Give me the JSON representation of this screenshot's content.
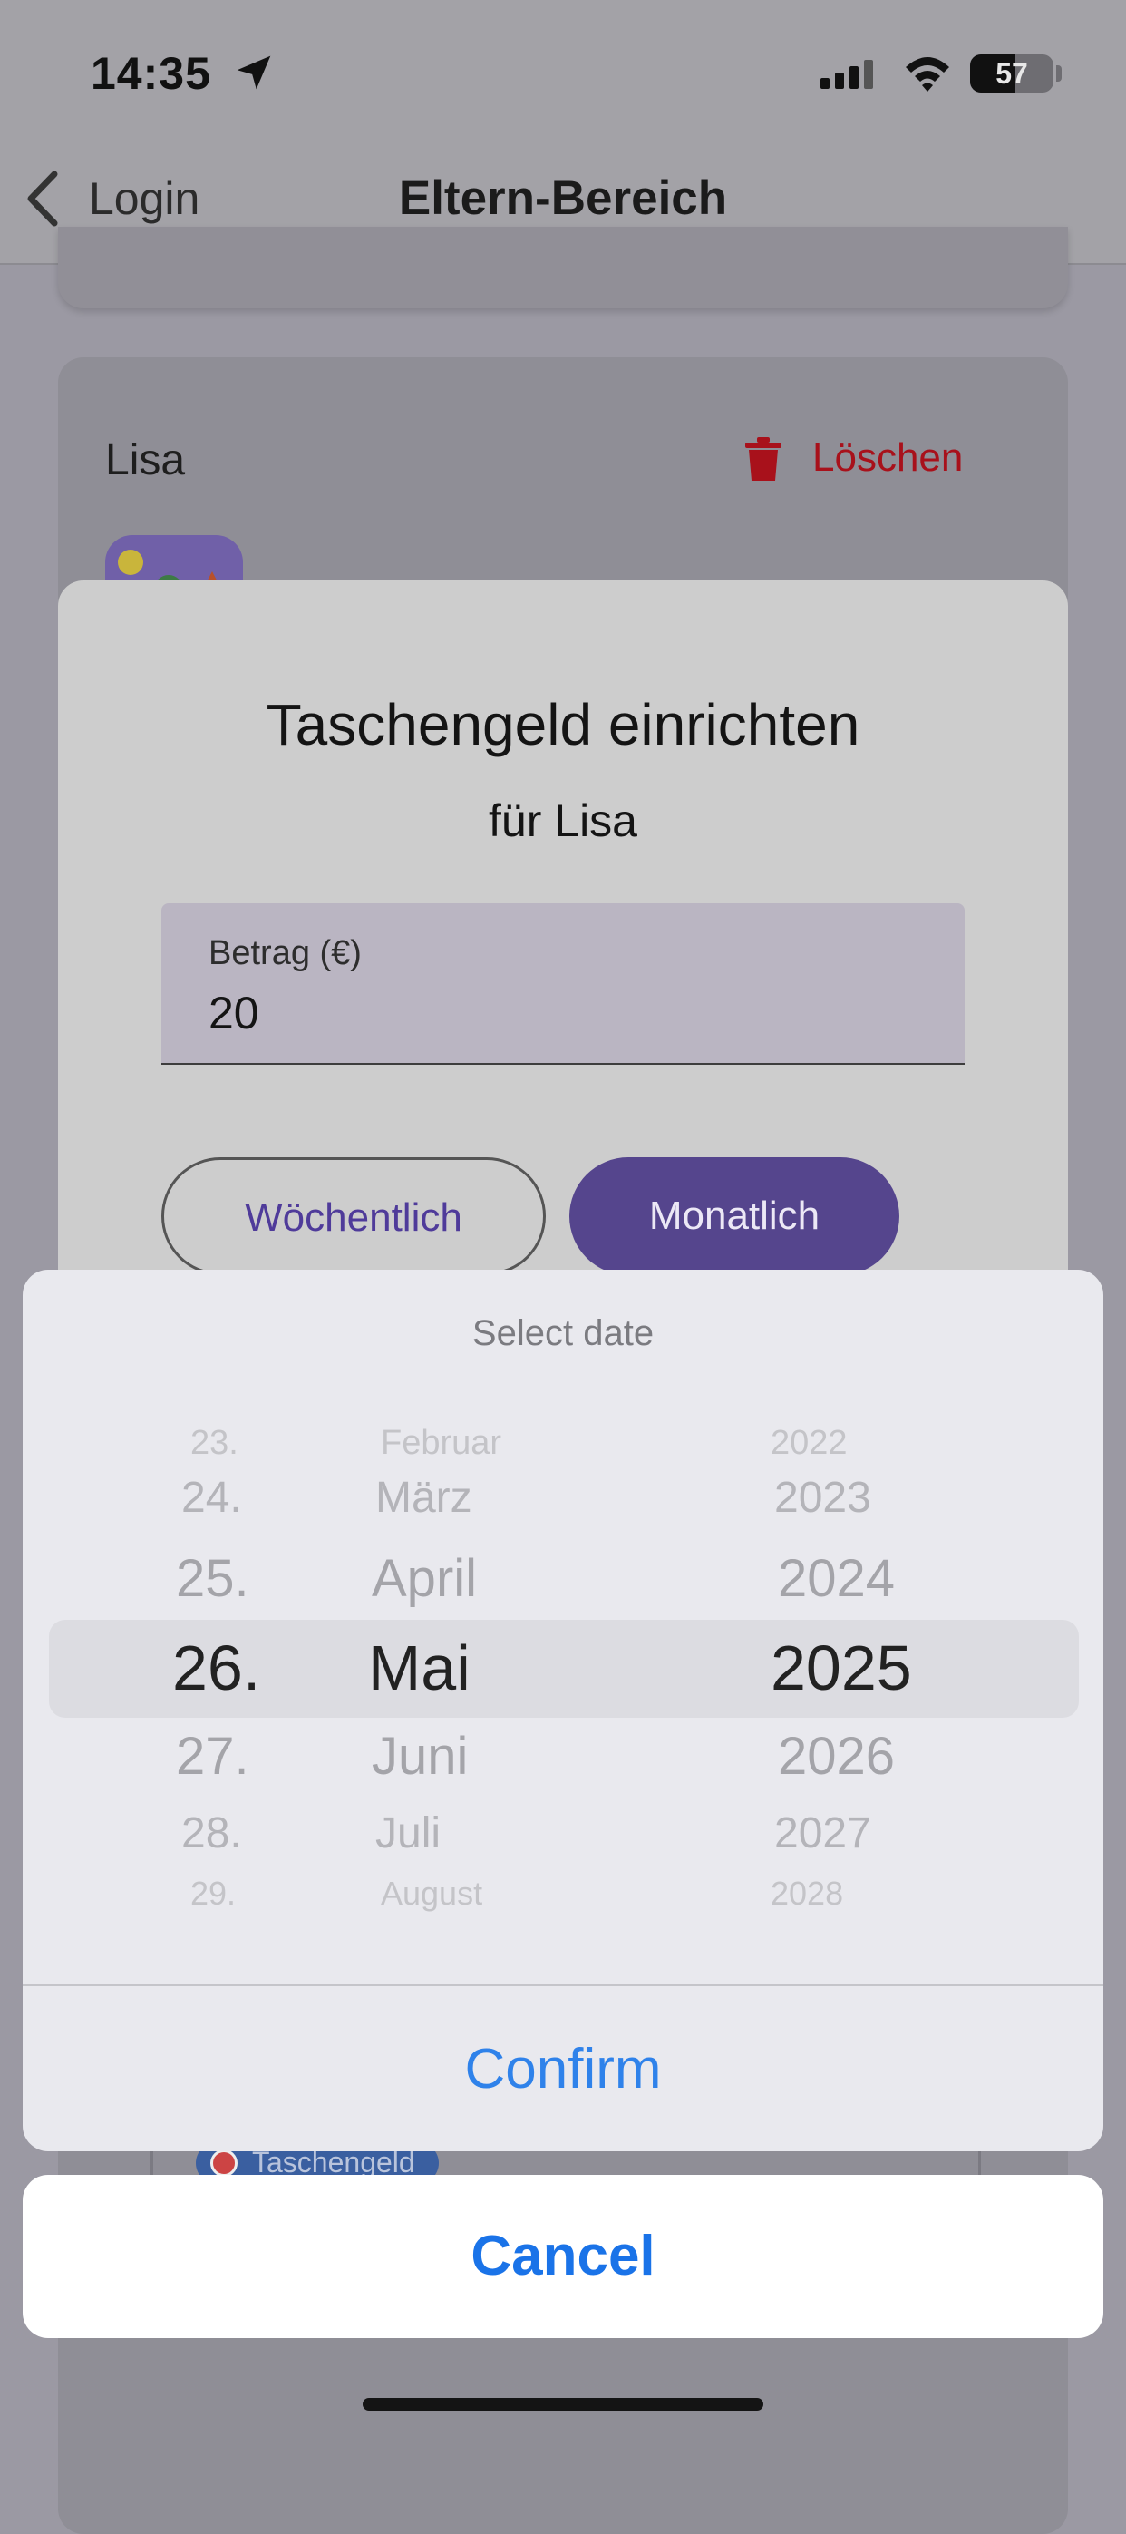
{
  "status_bar": {
    "time": "14:35",
    "battery": "57"
  },
  "nav": {
    "back_label": "Login",
    "title": "Eltern-Bereich"
  },
  "child_card": {
    "name": "Lisa",
    "delete_label": "Löschen",
    "chip_label": "Taschengeld"
  },
  "dialog": {
    "title": "Taschengeld einrichten",
    "subtitle": "für Lisa",
    "amount_field": {
      "label": "Betrag (€)",
      "value": "20"
    },
    "weekly_label": "Wöchentlich",
    "monthly_label": "Monatlich"
  },
  "date_picker": {
    "title": "Select date",
    "day_column": [
      {
        "text": "23.",
        "state": "far"
      },
      {
        "text": "24.",
        "state": "near2"
      },
      {
        "text": "25.",
        "state": "near1"
      },
      {
        "text": "26.",
        "state": "selected"
      },
      {
        "text": "27.",
        "state": "near1"
      },
      {
        "text": "28.",
        "state": "near2"
      },
      {
        "text": "29.",
        "state": "far"
      }
    ],
    "month_column": [
      {
        "text": "Februar",
        "state": "far"
      },
      {
        "text": "März",
        "state": "near2"
      },
      {
        "text": "April",
        "state": "near1"
      },
      {
        "text": "Mai",
        "state": "selected"
      },
      {
        "text": "Juni",
        "state": "near1"
      },
      {
        "text": "Juli",
        "state": "near2"
      },
      {
        "text": "August",
        "state": "far"
      }
    ],
    "year_column": [
      {
        "text": "2022",
        "state": "far"
      },
      {
        "text": "2023",
        "state": "near2"
      },
      {
        "text": "2024",
        "state": "near1"
      },
      {
        "text": "2025",
        "state": "selected"
      },
      {
        "text": "2026",
        "state": "near1"
      },
      {
        "text": "2027",
        "state": "near2"
      },
      {
        "text": "2028",
        "state": "far"
      }
    ],
    "confirm_label": "Confirm"
  },
  "cancel_label": "Cancel",
  "colors": {
    "accent_purple": "#55458d",
    "delete_red": "#a8111b",
    "ios_blue": "#1a73e8"
  }
}
